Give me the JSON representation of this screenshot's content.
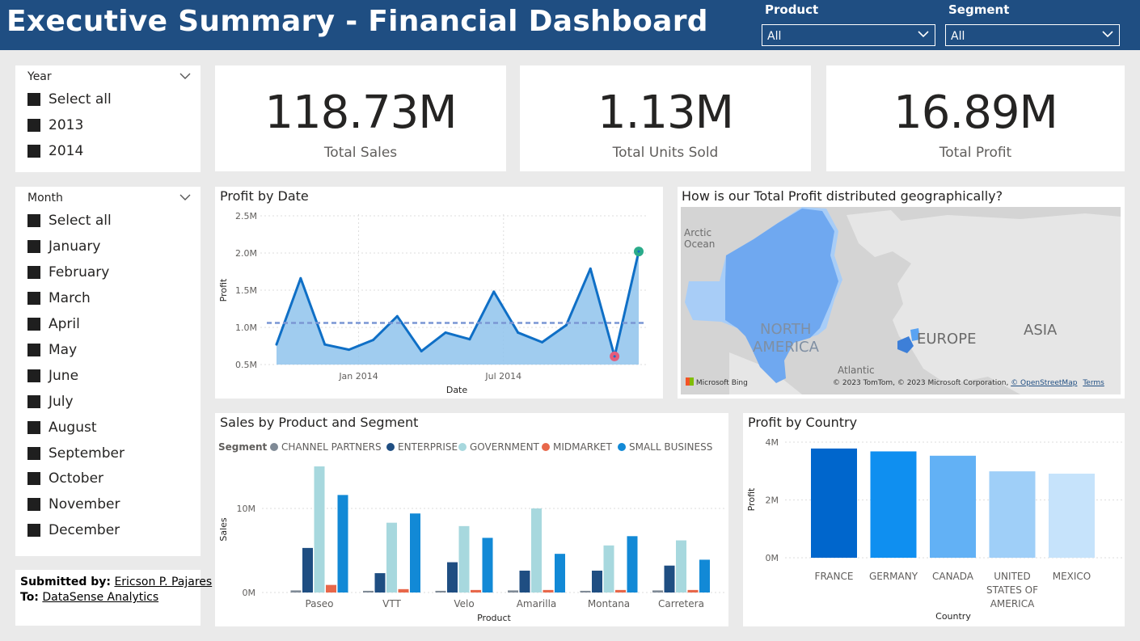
{
  "header": {
    "title": "Executive Summary - Financial Dashboard",
    "product_label": "Product",
    "product_value": "All",
    "segment_label": "Segment",
    "segment_value": "All"
  },
  "year_slicer": {
    "title": "Year",
    "items": [
      "Select all",
      "2013",
      "2014"
    ]
  },
  "month_slicer": {
    "title": "Month",
    "items": [
      "Select all",
      "January",
      "February",
      "March",
      "April",
      "May",
      "June",
      "July",
      "August",
      "September",
      "October",
      "November",
      "December"
    ]
  },
  "kpis": [
    {
      "value": "118.73M",
      "label": "Total Sales"
    },
    {
      "value": "1.13M",
      "label": "Total Units Sold"
    },
    {
      "value": "16.89M",
      "label": "Total Profit"
    }
  ],
  "footer": {
    "submitted_label": "Submitted by:",
    "submitted_name": "Ericson P. Pajares",
    "to_label": "To:",
    "to_name": "DataSense Analytics"
  },
  "map": {
    "title": "How is our Total Profit distributed geographically?",
    "labels": {
      "arctic_1": "Arctic",
      "arctic_2": "Ocean",
      "north_america_1": "NORTH",
      "north_america_2": "AMERICA",
      "europe": "EUROPE",
      "asia": "ASIA",
      "atlantic": "Atlantic"
    },
    "bing": "Microsoft Bing",
    "credit": "© 2023 TomTom, © 2023 Microsoft Corporation,",
    "osm": "© OpenStreetMap",
    "terms": "Terms",
    "colors": {
      "water": "#d4d4d4",
      "land": "#e6e6e6",
      "usa": "#6fa8f0",
      "canada": "#a8cdf7"
    }
  },
  "chart_data": [
    {
      "type": "area",
      "title": "Profit by Date",
      "xlabel": "Date",
      "ylabel": "Profit",
      "y_ticks": [
        "0.5M",
        "1.0M",
        "1.5M",
        "2.0M",
        "2.5M"
      ],
      "x_ticks": [
        "Jan 2014",
        "Jul 2014"
      ],
      "ylim": [
        0.5,
        2.5
      ],
      "x": [
        "2013-09",
        "2013-10",
        "2013-11",
        "2013-12",
        "2014-01",
        "2014-02",
        "2014-03",
        "2014-04",
        "2014-05",
        "2014-06",
        "2014-07",
        "2014-08",
        "2014-09",
        "2014-10",
        "2014-11",
        "2014-12"
      ],
      "values": [
        0.77,
        1.66,
        0.77,
        0.7,
        0.83,
        1.15,
        0.68,
        0.93,
        0.84,
        1.48,
        0.93,
        0.8,
        1.03,
        1.79,
        0.61,
        2.02
      ],
      "average": 1.06,
      "colors": {
        "line": "#0f6fc6",
        "fill": "#8fc3ec",
        "average": "#7a96d4",
        "max": "#2bab8a",
        "min": "#e55b7b"
      }
    },
    {
      "type": "bar",
      "title": "Sales by Product and Segment",
      "legend_title": "Segment",
      "xlabel": "Product",
      "ylabel": "Sales",
      "y_ticks": [
        "0M",
        "10M"
      ],
      "ylim": [
        0,
        15
      ],
      "categories": [
        "Paseo",
        "VTT",
        "Velo",
        "Amarilla",
        "Montana",
        "Carretera"
      ],
      "series": [
        {
          "name": "CHANNEL PARTNERS",
          "color": "#7f8a96",
          "values": [
            0.25,
            0.2,
            0.2,
            0.25,
            0.2,
            0.25
          ]
        },
        {
          "name": "ENTERPRISE",
          "color": "#1f4e82",
          "values": [
            5.3,
            2.3,
            3.6,
            2.6,
            2.6,
            3.2
          ]
        },
        {
          "name": "GOVERNMENT",
          "color": "#a7d8de",
          "values": [
            15.0,
            8.3,
            7.9,
            10.0,
            5.6,
            6.2
          ]
        },
        {
          "name": "MIDMARKET",
          "color": "#e8674a",
          "values": [
            0.9,
            0.4,
            0.3,
            0.3,
            0.3,
            0.3
          ]
        },
        {
          "name": "SMALL BUSINESS",
          "color": "#1289d6",
          "values": [
            11.6,
            9.4,
            6.5,
            4.6,
            6.7,
            3.9
          ]
        }
      ]
    },
    {
      "type": "bar",
      "title": "Profit by Country",
      "xlabel": "Country",
      "ylabel": "Profit",
      "y_ticks": [
        "0M",
        "2M",
        "4M"
      ],
      "ylim": [
        0,
        4
      ],
      "categories": [
        "FRANCE",
        "GERMANY",
        "CANADA",
        "UNITED STATES OF AMERICA",
        "MEXICO"
      ],
      "category_lines": [
        [
          "FRANCE"
        ],
        [
          "GERMANY"
        ],
        [
          "CANADA"
        ],
        [
          "UNITED",
          "STATES OF",
          "AMERICA"
        ],
        [
          "MEXICO"
        ]
      ],
      "values": [
        3.78,
        3.68,
        3.53,
        2.99,
        2.91
      ],
      "colors": [
        "#0066cc",
        "#0f8ff0",
        "#62b1f5",
        "#9fcff8",
        "#c6e3fb"
      ]
    }
  ]
}
